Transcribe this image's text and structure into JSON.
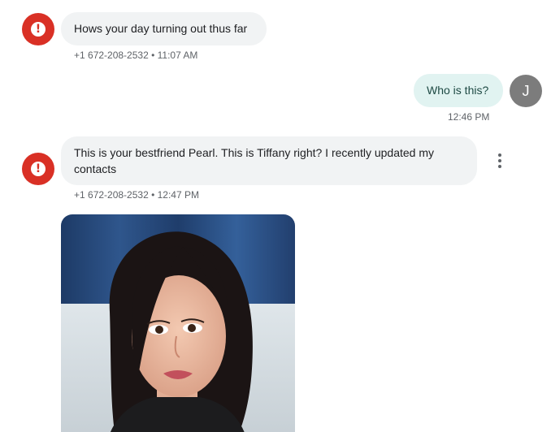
{
  "messages": [
    {
      "text": "Hows your day turning out thus far",
      "meta": "+1 672-208-2532 • 11:07 AM"
    },
    {
      "text": "Who is this?",
      "meta": "12:46 PM",
      "avatar_initial": "J"
    },
    {
      "text": "This is your bestfriend Pearl. This is Tiffany right? I recently updated my contacts",
      "meta": "+1 672-208-2532 • 12:47 PM"
    }
  ],
  "icons": {
    "warning": "error-icon",
    "more": "more-vert-icon"
  },
  "colors": {
    "warning_red": "#d93025",
    "incoming_bubble": "#f1f3f4",
    "outgoing_bubble": "#e1f3f1",
    "user_avatar": "#7c7c7c"
  }
}
